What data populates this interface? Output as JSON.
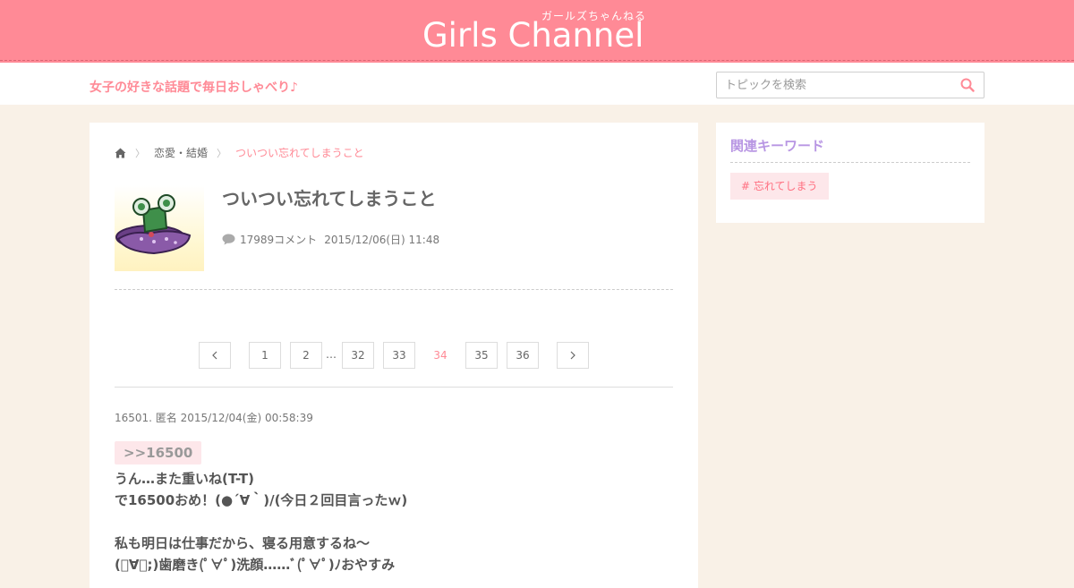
{
  "header": {
    "logo": "Girls Channel",
    "logo_sub": "ガールズちゃんねる",
    "tagline": "女子の好きな話題で毎日おしゃべり♪",
    "search_placeholder": "トピックを検索"
  },
  "breadcrumb": {
    "category": "恋愛・結婚",
    "current": "ついつい忘れてしまうこと"
  },
  "topic": {
    "title": "ついつい忘れてしまうこと",
    "comments": "17989コメント",
    "date": "2015/12/06(日) 11:48"
  },
  "pagination": {
    "pages": [
      "1",
      "2",
      "32",
      "33",
      "34",
      "35",
      "36"
    ],
    "current": "34",
    "ellipsis": "…"
  },
  "comment": {
    "meta": "16501. 匿名 2015/12/04(金) 00:58:39",
    "anchor": ">>16500",
    "text": "うん…また重いね(T-T)\nで16500おめ！(●´∀｀)/(今日２回目言ったｗ)\n\n私も明日は仕事だから、寝る用意するね～\n(ﾟ∀ﾟ;)歯磨き(ﾟ∀ﾟ)洗顔……ﾞ(ﾟ∀ﾟ)ﾉおやすみ"
  },
  "sidebar": {
    "keywords_title": "関連キーワード",
    "keywords": [
      "# 忘れてしまう"
    ]
  },
  "colors": {
    "brand": "#ff8a96",
    "keyword_title": "#b896e3",
    "background": "#f9f1e7"
  }
}
